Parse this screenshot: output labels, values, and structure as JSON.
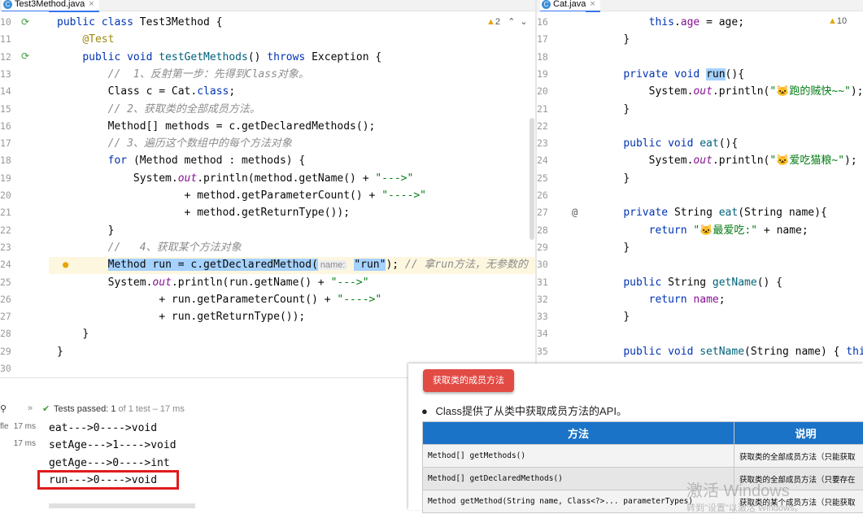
{
  "left_editor": {
    "tab": {
      "name": "Test3Method.java",
      "close": "×"
    },
    "inspection": {
      "count": "2"
    },
    "line_numbers": [
      "10",
      "11",
      "12",
      "13",
      "14",
      "15",
      "16",
      "17",
      "18",
      "19",
      "20",
      "21",
      "22",
      "23",
      "24",
      "25",
      "26",
      "27",
      "28",
      "29",
      "30"
    ],
    "lines": [
      [
        [
          "kw",
          "public "
        ],
        [
          "kw",
          "class "
        ],
        [
          "",
          "Test3Method {"
        ]
      ],
      [
        [
          "",
          "    "
        ],
        [
          "ann",
          "@Test"
        ]
      ],
      [
        [
          "",
          "    "
        ],
        [
          "kw",
          "public void "
        ],
        [
          "fn",
          "testGetMethods"
        ],
        [
          "",
          "() "
        ],
        [
          "kw",
          "throws "
        ],
        [
          "",
          "Exception {"
        ]
      ],
      [
        [
          "",
          "        "
        ],
        [
          "cm",
          "//  1、反射第一步：先得到Class对象。"
        ]
      ],
      [
        [
          "",
          "        "
        ],
        [
          "",
          "Class"
        ],
        [
          "",
          " c = Cat."
        ],
        [
          "kw",
          "class"
        ],
        [
          "",
          ";"
        ]
      ],
      [
        [
          "",
          "        "
        ],
        [
          "cm",
          "// 2、获取类的全部成员方法。"
        ]
      ],
      [
        [
          "",
          "        "
        ],
        [
          "",
          "Method[] methods = c.getDeclaredMethods();"
        ]
      ],
      [
        [
          "",
          "        "
        ],
        [
          "cm",
          "// 3、遍历这个数组中的每个方法对象"
        ]
      ],
      [
        [
          "",
          "        "
        ],
        [
          "kw",
          "for "
        ],
        [
          "",
          "(Method method : methods) {"
        ]
      ],
      [
        [
          "",
          "            "
        ],
        [
          "",
          "System."
        ],
        [
          "st",
          "out"
        ],
        [
          "",
          ".println(method.getName() + "
        ],
        [
          "str",
          "\"--->\""
        ]
      ],
      [
        [
          "",
          "                    "
        ],
        [
          "",
          "+ method.getParameterCount() + "
        ],
        [
          "str",
          "\"---->\""
        ]
      ],
      [
        [
          "",
          "                    "
        ],
        [
          "",
          "+ method.getReturnType());"
        ]
      ],
      [
        [
          "",
          "        "
        ],
        [
          "",
          "}"
        ]
      ],
      [
        [
          "",
          "        "
        ],
        [
          "cm",
          "//   4、获取某个方法对象"
        ]
      ],
      [
        [
          "",
          "        "
        ],
        [
          "sel",
          "Method run = c.getDeclaredMethod("
        ],
        [
          "hint",
          "name:"
        ],
        [
          "",
          " "
        ],
        [
          "sel",
          "\"run\""
        ],
        [
          "",
          ");"
        ],
        [
          "cm",
          " // 拿run方法，无参数的"
        ]
      ],
      [
        [
          "",
          "        "
        ],
        [
          "",
          "System."
        ],
        [
          "st",
          "out"
        ],
        [
          "",
          ".println(run.getName() + "
        ],
        [
          "str",
          "\"--->\""
        ]
      ],
      [
        [
          "",
          "                "
        ],
        [
          "",
          "+ run.getParameterCount() + "
        ],
        [
          "str",
          "\"---->\""
        ]
      ],
      [
        [
          "",
          "                "
        ],
        [
          "",
          "+ run.getReturnType());"
        ]
      ],
      [
        [
          "",
          "    "
        ],
        [
          "",
          "}"
        ]
      ],
      [
        [
          "",
          "}"
        ]
      ],
      [
        [
          "",
          ""
        ]
      ]
    ]
  },
  "right_editor": {
    "tab": {
      "name": "Cat.java",
      "close": "×"
    },
    "inspection": {
      "count": "10"
    },
    "line_numbers": [
      "16",
      "17",
      "18",
      "19",
      "20",
      "21",
      "22",
      "23",
      "24",
      "25",
      "26",
      "27",
      "28",
      "29",
      "30",
      "31",
      "32",
      "33",
      "34",
      "35"
    ],
    "lines": [
      [
        [
          "",
          "        "
        ],
        [
          "kw",
          "this"
        ],
        [
          "",
          "."
        ],
        [
          "fld",
          "age"
        ],
        [
          "",
          " = age;"
        ]
      ],
      [
        [
          "",
          "    "
        ],
        [
          "",
          "}"
        ]
      ],
      [
        [
          "",
          ""
        ]
      ],
      [
        [
          "",
          "    "
        ],
        [
          "kw",
          "private void "
        ],
        [
          "sel",
          "run"
        ],
        [
          "",
          "(){"
        ]
      ],
      [
        [
          "",
          "        "
        ],
        [
          "",
          "System."
        ],
        [
          "st",
          "out"
        ],
        [
          "",
          ".println("
        ],
        [
          "str",
          "\"🐱跑的贼快~~\""
        ],
        [
          "",
          ");"
        ]
      ],
      [
        [
          "",
          "    "
        ],
        [
          "",
          "}"
        ]
      ],
      [
        [
          "",
          ""
        ]
      ],
      [
        [
          "",
          "    "
        ],
        [
          "kw",
          "public void "
        ],
        [
          "fn",
          "eat"
        ],
        [
          "",
          "(){"
        ]
      ],
      [
        [
          "",
          "        "
        ],
        [
          "",
          "System."
        ],
        [
          "st",
          "out"
        ],
        [
          "",
          ".println("
        ],
        [
          "str",
          "\"🐱爱吃猫粮~\""
        ],
        [
          "",
          ");"
        ]
      ],
      [
        [
          "",
          "    "
        ],
        [
          "",
          "}"
        ]
      ],
      [
        [
          "",
          ""
        ]
      ],
      [
        [
          "",
          "    "
        ],
        [
          "kw",
          "private "
        ],
        [
          "",
          "String "
        ],
        [
          "fn",
          "eat"
        ],
        [
          "",
          "(String name){"
        ]
      ],
      [
        [
          "",
          "        "
        ],
        [
          "kw",
          "return "
        ],
        [
          "str",
          "\"🐱最爱吃:\""
        ],
        [
          "",
          " + name;"
        ]
      ],
      [
        [
          "",
          "    "
        ],
        [
          "",
          "}"
        ]
      ],
      [
        [
          "",
          ""
        ]
      ],
      [
        [
          "",
          "    "
        ],
        [
          "kw",
          "public "
        ],
        [
          "",
          "String "
        ],
        [
          "fn",
          "getName"
        ],
        [
          "",
          "() {"
        ]
      ],
      [
        [
          "",
          "        "
        ],
        [
          "kw",
          "return "
        ],
        [
          "fld",
          "name"
        ],
        [
          "",
          ";"
        ]
      ],
      [
        [
          "",
          "    "
        ],
        [
          "",
          "}"
        ]
      ],
      [
        [
          "",
          ""
        ]
      ],
      [
        [
          "",
          "    "
        ],
        [
          "kw",
          "public void "
        ],
        [
          "fn",
          "setName"
        ],
        [
          "",
          "(String name) { "
        ],
        [
          "kw",
          "thi"
        ]
      ]
    ]
  },
  "run_panel": {
    "status_prefix": "Tests passed: ",
    "status_count": "1",
    "status_rest": " of 1 test – 17 ms",
    "tree": [
      {
        "label": "fle",
        "time": "17 ms"
      },
      {
        "label": "",
        "time": "17 ms"
      }
    ],
    "output": [
      "eat--->0---->void",
      "setAge--->1---->void",
      "getAge--->0---->int",
      "run--->0---->void"
    ]
  },
  "slide": {
    "badge": "获取类的成员方法",
    "bullet": "Class提供了从类中获取成员方法的API。",
    "table": {
      "headers": [
        "方法",
        "说明"
      ],
      "rows": [
        [
          "Method[] getMethods()",
          "获取类的全部成员方法（只能获取"
        ],
        [
          "Method[] getDeclaredMethods()",
          "获取类的全部成员方法（只要存在"
        ],
        [
          "Method getMethod(String name, Class<?>... parameterTypes)",
          "获取类的某个成员方法（只能获取"
        ]
      ]
    },
    "watermark": {
      "line1": "激活 Windows",
      "line2": "转到\"设置\"以激活 Windows。"
    }
  },
  "colors": {
    "keyword": "#0033b3",
    "string": "#067d17",
    "comment": "#8c8c8c",
    "highlight_box": "#e01b1b",
    "badge": "#e24a44",
    "table_header": "#1a73c7"
  }
}
